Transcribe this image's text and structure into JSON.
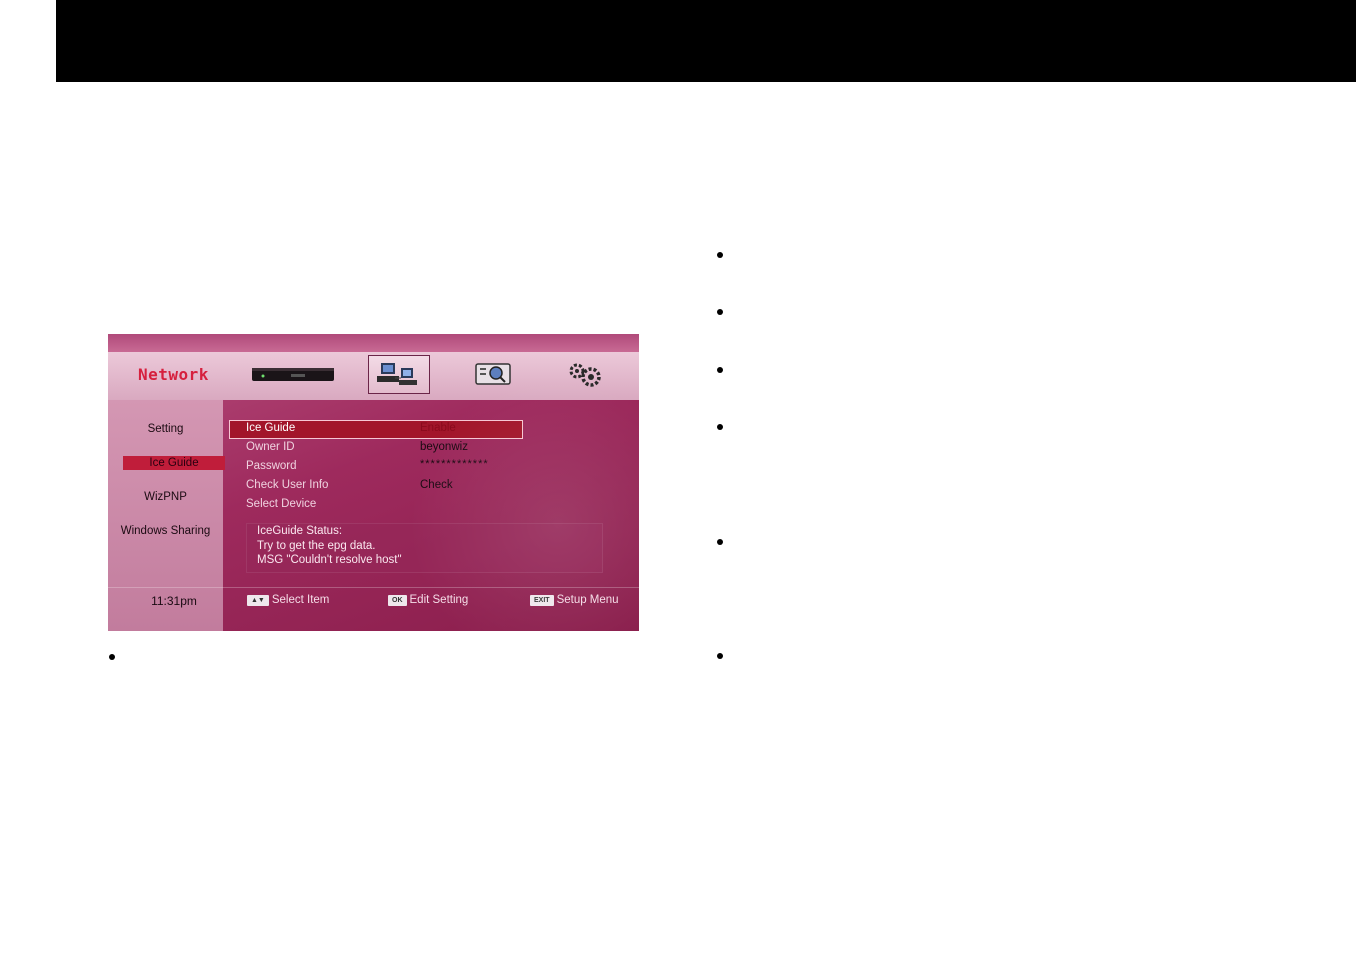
{
  "tv_menu": {
    "title": "Network",
    "tabs": [
      {
        "icon": "receiver-icon"
      },
      {
        "icon": "network-icon"
      },
      {
        "icon": "search-icon"
      },
      {
        "icon": "gears-icon"
      }
    ],
    "sidebar": [
      {
        "label": "Setting"
      },
      {
        "label": "Ice Guide"
      },
      {
        "label": "WizPNP"
      },
      {
        "label": "Windows Sharing"
      }
    ],
    "settings": [
      {
        "label": "Ice Guide",
        "value": "Enable"
      },
      {
        "label": "Owner ID",
        "value": "beyonwiz"
      },
      {
        "label": "Password",
        "value": "*************"
      },
      {
        "label": "Check User Info",
        "value": "Check"
      },
      {
        "label": "Select Device",
        "value": ""
      }
    ],
    "status": {
      "line1": "IceGuide Status:",
      "line2": "Try to get the epg data.",
      "line3": "MSG \"Couldn't resolve host\""
    },
    "footer": {
      "time": "11:31pm",
      "select_key": "▲▼",
      "select_label": "Select Item",
      "ok_key": "OK",
      "ok_label": "Edit Setting",
      "exit_key": "EXIT",
      "exit_label": "Setup Menu"
    }
  },
  "colors": {
    "header_bar": "#000000",
    "tv_background": "#9e2a5d",
    "highlight": "#a2152a",
    "title_red": "#d6203e"
  }
}
